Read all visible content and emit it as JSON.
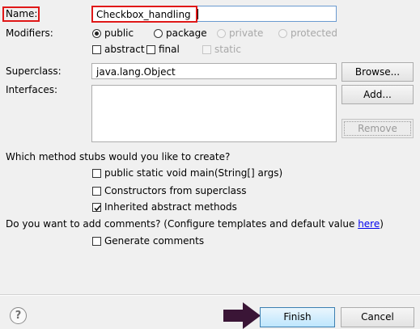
{
  "name": {
    "label": "Name:",
    "value": "Checkbox_handling"
  },
  "modifiers": {
    "label": "Modifiers:",
    "public": "public",
    "package": "package",
    "private": "private",
    "protected": "protected",
    "abstract": "abstract",
    "final": "final",
    "static": "static"
  },
  "superclass": {
    "label": "Superclass:",
    "value": "java.lang.Object",
    "browse": "Browse..."
  },
  "interfaces": {
    "label": "Interfaces:",
    "add": "Add...",
    "remove": "Remove"
  },
  "stubs": {
    "question": "Which method stubs would you like to create?",
    "main": "public static void main(String[] args)",
    "constructors": "Constructors from superclass",
    "inherited": "Inherited abstract methods"
  },
  "comments": {
    "question_prefix": "Do you want to add comments? (Configure templates and default value ",
    "link": "here",
    "question_suffix": ")",
    "generate": "Generate comments"
  },
  "footer": {
    "finish": "Finish",
    "cancel": "Cancel",
    "help_glyph": "?"
  },
  "colors": {
    "highlight": "#e01818",
    "arrow": "#3a1536",
    "link": "#0000ee"
  }
}
